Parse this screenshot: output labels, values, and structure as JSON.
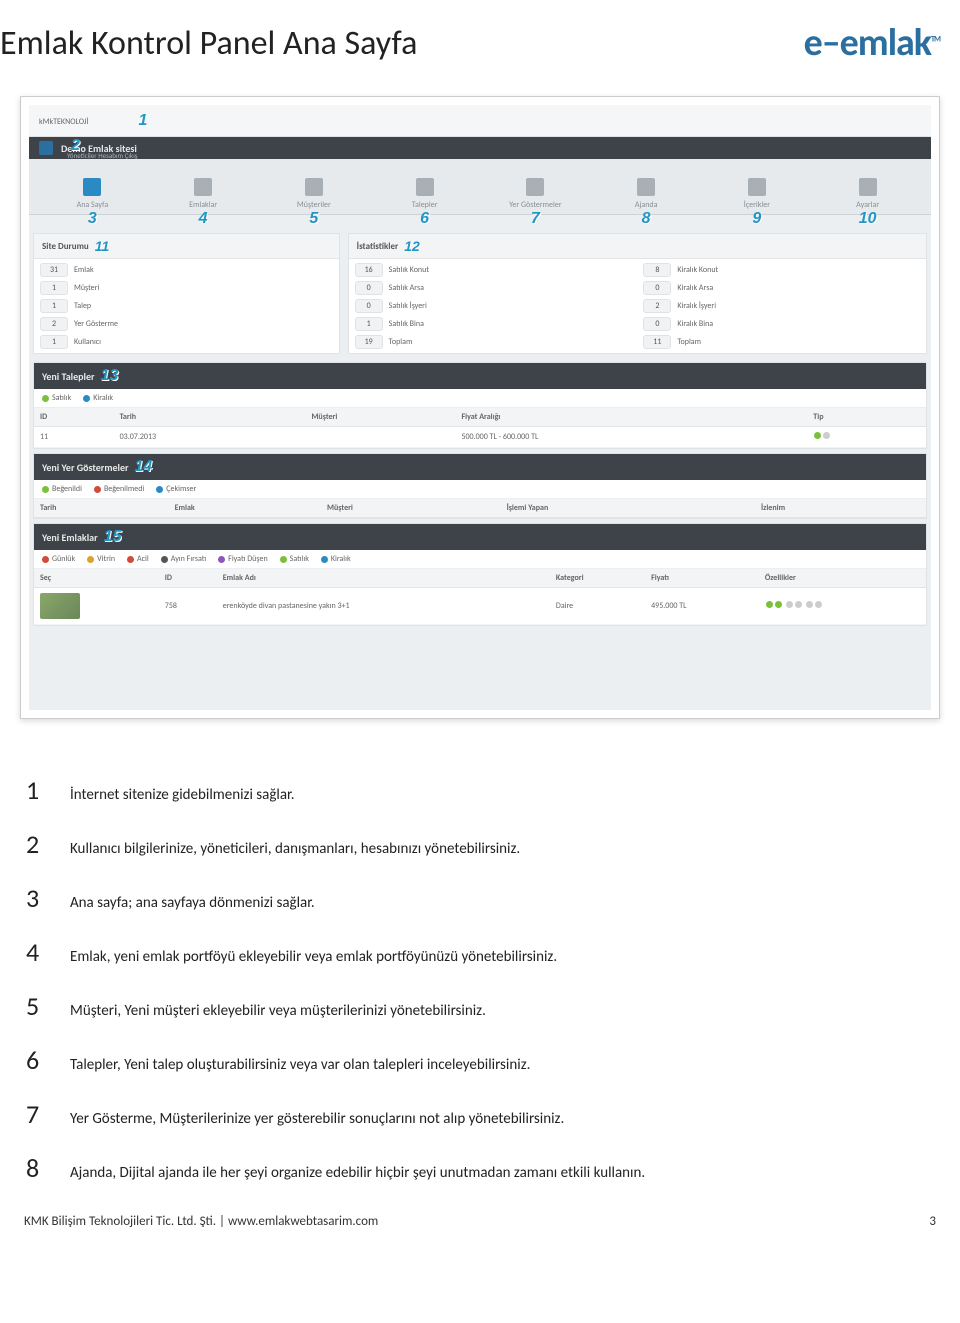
{
  "header": {
    "title": "Emlak Kontrol Panel Ana Sayfa",
    "brand": "e–emlak",
    "tm": "TM"
  },
  "shot": {
    "topbar": {
      "logo_main": "kMk",
      "logo_sub": "TEKNOLOJİ",
      "num1": "1"
    },
    "sitebar": {
      "title": "Demo Emlak sitesi",
      "sub": "Yöneticiler   Hesabım   Çıkış",
      "num2": "2"
    },
    "nav": [
      {
        "label": "Ana Sayfa",
        "num": "3"
      },
      {
        "label": "Emlaklar",
        "num": "4"
      },
      {
        "label": "Müşteriler",
        "num": "5"
      },
      {
        "label": "Talepler",
        "num": "6"
      },
      {
        "label": "Yer Göstermeler",
        "num": "7"
      },
      {
        "label": "Ajanda",
        "num": "8"
      },
      {
        "label": "İçerikler",
        "num": "9"
      },
      {
        "label": "Ayarlar",
        "num": "10"
      }
    ],
    "site_durumu": {
      "title": "Site Durumu",
      "num": "11",
      "rows": [
        {
          "n": "31",
          "l": "Emlak"
        },
        {
          "n": "1",
          "l": "Müşteri"
        },
        {
          "n": "1",
          "l": "Talep"
        },
        {
          "n": "2",
          "l": "Yer Gösterme"
        },
        {
          "n": "1",
          "l": "Kullanıcı"
        }
      ]
    },
    "istatistikler": {
      "title": "İstatistikler",
      "num": "12",
      "left": [
        {
          "n": "16",
          "l": "Satılık Konut"
        },
        {
          "n": "0",
          "l": "Satılık Arsa"
        },
        {
          "n": "0",
          "l": "Satılık İşyeri"
        },
        {
          "n": "1",
          "l": "Satılık Bina"
        },
        {
          "n": "19",
          "l": "Toplam"
        }
      ],
      "right": [
        {
          "n": "8",
          "l": "Kiralık Konut"
        },
        {
          "n": "0",
          "l": "Kiralık Arsa"
        },
        {
          "n": "2",
          "l": "Kiralık İşyeri"
        },
        {
          "n": "0",
          "l": "Kiralık Bina"
        },
        {
          "n": "11",
          "l": "Toplam"
        }
      ]
    },
    "yeni_talepler": {
      "title": "Yeni Talepler",
      "num": "13",
      "legend": [
        {
          "c": "dot-g",
          "l": "Satılık"
        },
        {
          "c": "dot-b",
          "l": "Kiralık"
        }
      ],
      "cols": [
        "ID",
        "Tarih",
        "Müşteri",
        "Fiyat Aralığı",
        "Tip"
      ],
      "row": {
        "id": "11",
        "tarih": "03.07.2013",
        "musteri": "",
        "fiyat": "500.000 TL - 600.000 TL"
      }
    },
    "yeni_yer": {
      "title": "Yeni Yer Göstermeler",
      "num": "14",
      "legend": [
        {
          "c": "dot-g",
          "l": "Beğenildi"
        },
        {
          "c": "dot-r",
          "l": "Beğenilmedi"
        },
        {
          "c": "dot-b",
          "l": "Çekimser"
        }
      ],
      "cols": [
        "Tarih",
        "Emlak",
        "Müşteri",
        "İşlemi Yapan",
        "İzlenim"
      ]
    },
    "yeni_emlaklar": {
      "title": "Yeni Emlaklar",
      "num": "15",
      "legend": [
        {
          "c": "dot-r",
          "l": "Günlük"
        },
        {
          "c": "dot-y",
          "l": "Vitrin"
        },
        {
          "c": "dot-r",
          "l": "Acil"
        },
        {
          "c": "dot-k",
          "l": "Ayın Fırsatı"
        },
        {
          "c": "dot-p",
          "l": "Fiyatı Düşen"
        },
        {
          "c": "dot-g",
          "l": "Satılık"
        },
        {
          "c": "dot-b",
          "l": "Kiralık"
        }
      ],
      "cols": [
        "Seç",
        "ID",
        "Emlak Adı",
        "Kategori",
        "Fiyatı",
        "Özellikler"
      ],
      "row": {
        "id": "758",
        "ad": "erenköyde divan pastanesine yakın 3+1",
        "kat": "Daire",
        "fiyat": "495.000 TL"
      }
    }
  },
  "desc": [
    {
      "n": "1",
      "t": "İnternet sitenize gidebilmenizi sağlar."
    },
    {
      "n": "2",
      "t": "Kullanıcı bilgilerinize, yöneticileri, danışmanları, hesabınızı yönetebilirsiniz."
    },
    {
      "n": "3",
      "t": "Ana sayfa; ana sayfaya dönmenizi sağlar."
    },
    {
      "n": "4",
      "t": "Emlak, yeni emlak portföyü ekleyebilir veya emlak portföyünüzü yönetebilirsiniz."
    },
    {
      "n": "5",
      "t": "Müşteri, Yeni müşteri ekleyebilir veya müşterilerinizi yönetebilirsiniz."
    },
    {
      "n": "6",
      "t": "Talepler, Yeni talep oluşturabilirsiniz veya var olan talepleri inceleyebilirsiniz."
    },
    {
      "n": "7",
      "t": "Yer Gösterme, Müşterilerinize yer gösterebilir sonuçlarını not alıp yönetebilirsiniz."
    },
    {
      "n": "8",
      "t": "Ajanda, Dijital ajanda ile her şeyi organize edebilir hiçbir şeyi unutmadan zamanı etkili kullanın."
    }
  ],
  "footer": {
    "left": "KMK Bilişim Teknolojileri Tic. Ltd. Şti. | www.emlakwebtasarim.com",
    "right": "3"
  }
}
